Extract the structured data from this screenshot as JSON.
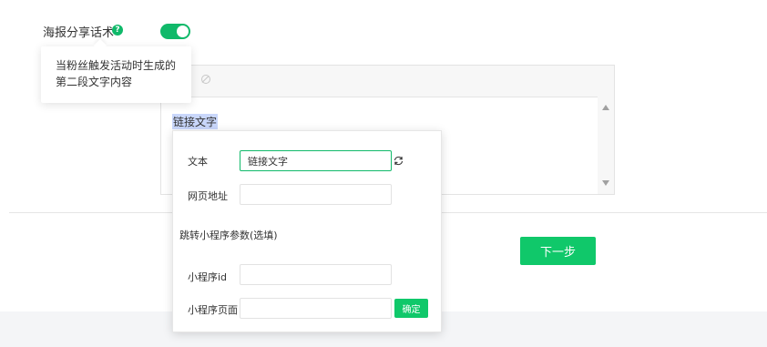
{
  "form": {
    "poster_share_label": "海报分享话术",
    "help_symbol": "?",
    "toggle_on": true,
    "accent_color": "#10b96a",
    "tooltip_line1": "当粉丝触发活动时生成的",
    "tooltip_line2": "第二段文字内容",
    "editor_link_text": "链接文字",
    "next_button": "下一步"
  },
  "link_popup": {
    "text_label": "文本",
    "text_value": "链接文字",
    "url_label": "网页地址",
    "url_value": "",
    "miniprogram_section": "跳转小程序参数(选填)",
    "appid_label": "小程序id",
    "appid_value": "",
    "page_label": "小程序页面",
    "page_value": "",
    "confirm_button": "确定",
    "refresh_icon": "refresh-icon"
  }
}
